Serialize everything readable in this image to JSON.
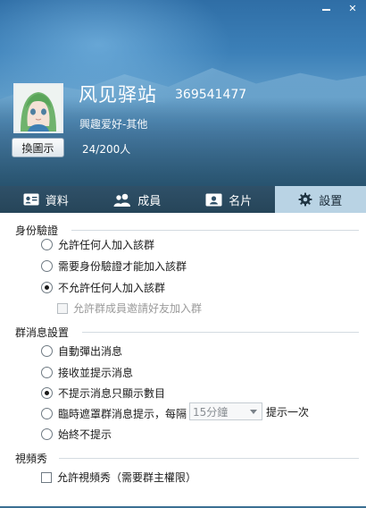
{
  "window": {
    "minimize_label": "",
    "close_label": "✕"
  },
  "group": {
    "name": "风见驿站",
    "id": "369541477",
    "interest": "興趣爱好-其他",
    "member_count": "24/200人",
    "change_avatar_label": "換圖示"
  },
  "tabs": [
    {
      "label": "資料",
      "icon": "id-card-icon",
      "active": false
    },
    {
      "label": "成員",
      "icon": "members-icon",
      "active": false
    },
    {
      "label": "名片",
      "icon": "business-card-icon",
      "active": false
    },
    {
      "label": "設置",
      "icon": "gear-icon",
      "active": true
    }
  ],
  "auth": {
    "title": "身份驗證",
    "options": [
      {
        "label": "允許任何人加入該群",
        "selected": false
      },
      {
        "label": "需要身份驗證才能加入該群",
        "selected": false
      },
      {
        "label": "不允許任何人加入該群",
        "selected": true
      }
    ],
    "invite_checkbox": {
      "label": "允許群成員邀請好友加入群",
      "checked": false,
      "disabled": true
    }
  },
  "message": {
    "title": "群消息設置",
    "options": [
      {
        "label": "自動彈出消息",
        "selected": false
      },
      {
        "label": "接收並提示消息",
        "selected": false
      },
      {
        "label": "不提示消息只顯示數目",
        "selected": true
      },
      {
        "label": "臨時遮罩群消息提示，每隔",
        "selected": false
      },
      {
        "label": "始終不提示",
        "selected": false
      }
    ],
    "interval_select": {
      "value": "15分鐘"
    },
    "interval_suffix": "提示一次"
  },
  "video": {
    "title": "視頻秀",
    "checkbox": {
      "label": "允許視頻秀（需要群主權限）",
      "checked": false
    }
  },
  "colors": {
    "header_top": "#2f6ea6",
    "tab_bar": "#2f5068",
    "tab_active": "#b9d3e4"
  }
}
